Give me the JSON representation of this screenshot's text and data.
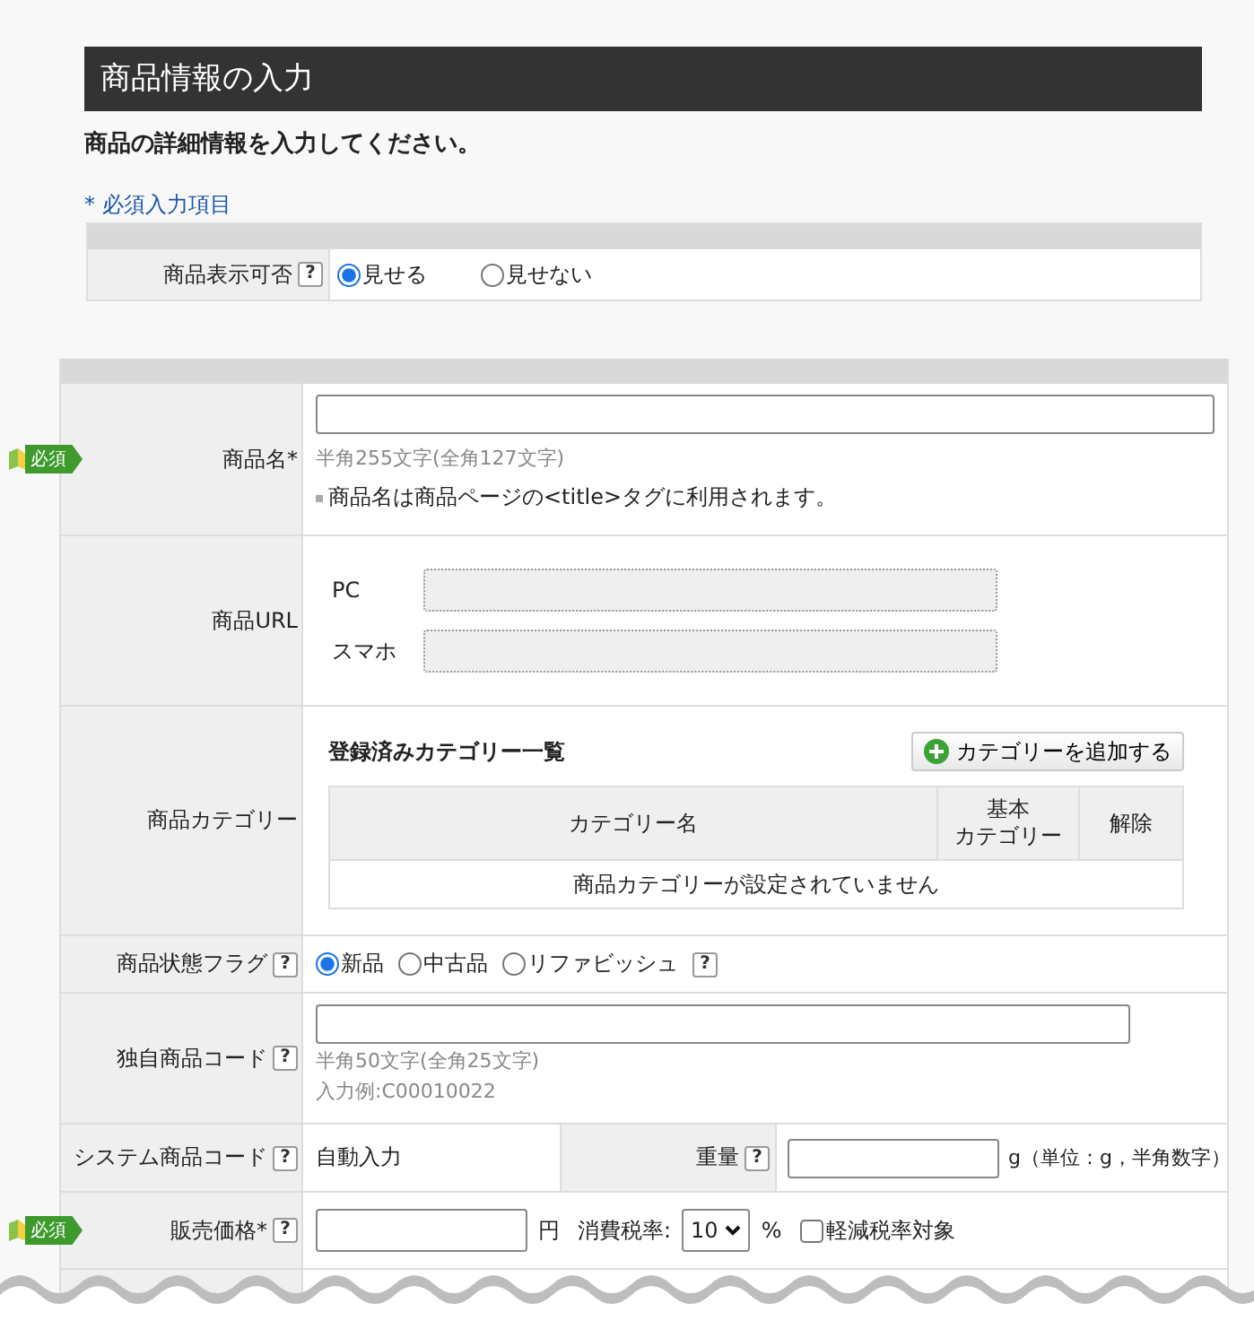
{
  "header": {
    "title": "商品情報の入力",
    "subtitle": "商品の詳細情報を入力してください。",
    "required_note": "* 必須入力項目"
  },
  "display_setting": {
    "label": "商品表示可否",
    "help": "?",
    "options": [
      {
        "label": "見せる",
        "selected": true
      },
      {
        "label": "見せない",
        "selected": false
      }
    ]
  },
  "fields": [
    {
      "kind": "text",
      "label": "商品名*",
      "required": "必須",
      "hint": "半角255文字(全角127文字)",
      "note": "商品名は商品ページの<title>タグに利用されます。"
    },
    {
      "kind": "url",
      "label": "商品URL",
      "inputs": [
        {
          "label": "PC",
          "disabled": true
        },
        {
          "label": "スマホ",
          "disabled": true
        }
      ]
    },
    {
      "kind": "category",
      "label": "商品カテゴリー",
      "heading": "登録済みカテゴリー一覧",
      "add_button": "カテゴリーを追加する",
      "columns": [
        {
          "lines": [
            "カテゴリー名"
          ]
        },
        {
          "lines": [
            "基本",
            "カテゴリー"
          ]
        },
        {
          "lines": [
            "解除"
          ]
        }
      ],
      "empty": "商品カテゴリーが設定されていません"
    },
    {
      "kind": "radio",
      "label": "商品状態フラグ",
      "help": "?",
      "options": [
        {
          "label": "新品",
          "selected": true
        },
        {
          "label": "中古品",
          "selected": false
        },
        {
          "label": "リファビッシュ",
          "selected": false
        }
      ],
      "option_help": "?"
    },
    {
      "kind": "code",
      "label": "独自商品コード",
      "help": "?",
      "hints": [
        "半角50文字(全角25文字)",
        "入力例:C00010022"
      ]
    },
    {
      "kind": "system",
      "label": "システム商品コード",
      "help": "?",
      "value": "自動入力",
      "weight_label": "重量",
      "weight_help": "?",
      "weight_unit": "g（単位：g，半角数字）"
    },
    {
      "kind": "price",
      "label": "販売価格*",
      "required": "必須",
      "help": "?",
      "unit": "円",
      "tax_label": "消費税率:",
      "tax_value": "10",
      "percent": "%",
      "reduced": {
        "label": "軽減税率対象",
        "checked": false
      }
    }
  ]
}
